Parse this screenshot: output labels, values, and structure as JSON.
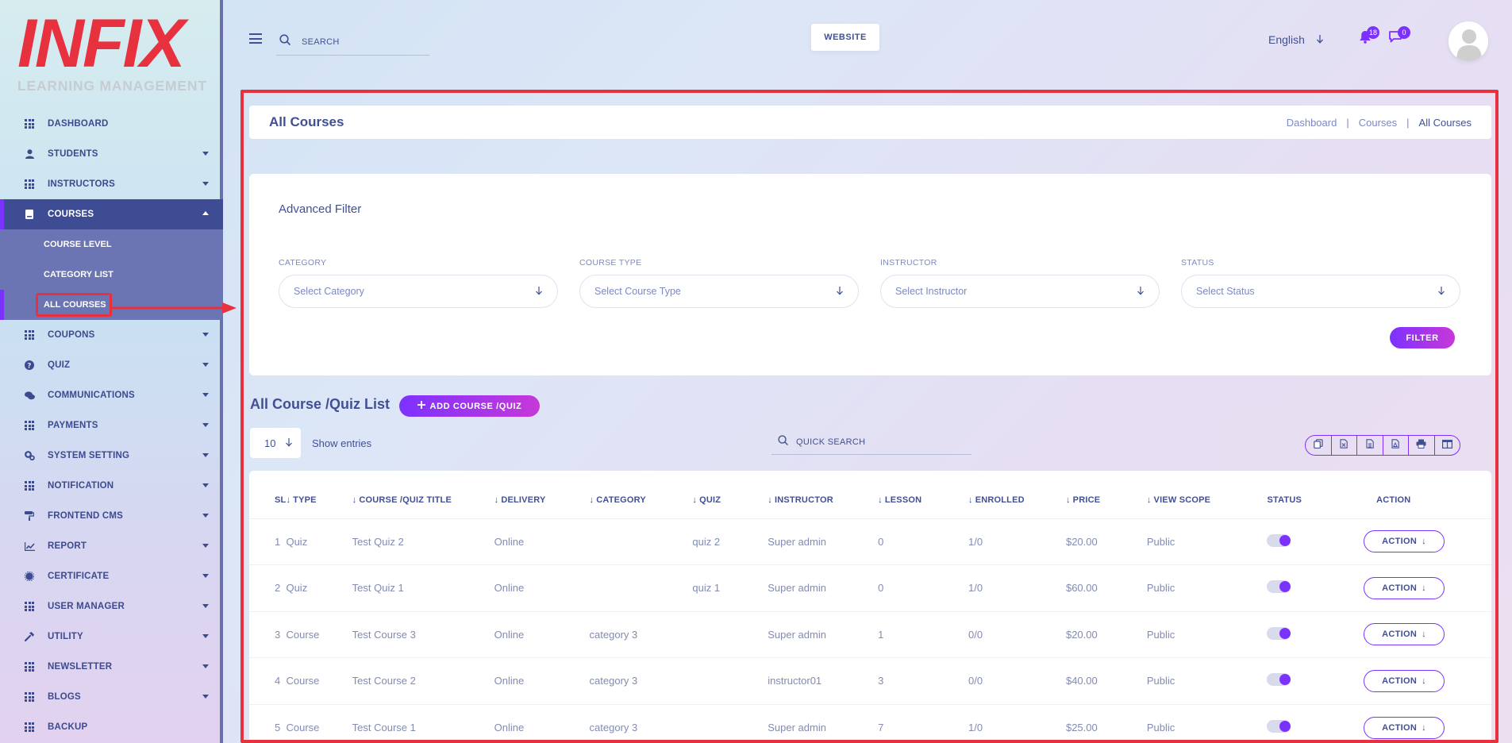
{
  "logo": {
    "word": "INFIX",
    "subtitle": "LEARNING MANAGEMENT"
  },
  "sidebar": {
    "items": [
      {
        "label": "DASHBOARD",
        "icon": "grid-icon"
      },
      {
        "label": "STUDENTS",
        "icon": "user-icon"
      },
      {
        "label": "INSTRUCTORS",
        "icon": "grid-icon"
      },
      {
        "label": "COURSES",
        "icon": "book-icon"
      },
      {
        "label": "COUPONS",
        "icon": "grid-icon"
      },
      {
        "label": "QUIZ",
        "icon": "question-icon"
      },
      {
        "label": "COMMUNICATIONS",
        "icon": "chat-icon"
      },
      {
        "label": "PAYMENTS",
        "icon": "grid-icon"
      },
      {
        "label": "SYSTEM SETTING",
        "icon": "cogs-icon"
      },
      {
        "label": "NOTIFICATION",
        "icon": "grid-icon"
      },
      {
        "label": "FRONTEND CMS",
        "icon": "paint-icon"
      },
      {
        "label": "REPORT",
        "icon": "chart-icon"
      },
      {
        "label": "CERTIFICATE",
        "icon": "certificate-icon"
      },
      {
        "label": "USER MANAGER",
        "icon": "grid-icon"
      },
      {
        "label": "UTILITY",
        "icon": "wrench-icon"
      },
      {
        "label": "NEWSLETTER",
        "icon": "grid-icon"
      },
      {
        "label": "BLOGS",
        "icon": "grid-icon"
      },
      {
        "label": "BACKUP",
        "icon": "grid-icon"
      }
    ],
    "courses_sub": [
      "COURSE LEVEL",
      "CATEGORY LIST",
      "ALL COURSES"
    ]
  },
  "header": {
    "search_placeholder": "SEARCH",
    "website_label": "WEBSITE",
    "language": "English",
    "notification_count": "18",
    "message_count": "0"
  },
  "page": {
    "title": "All Courses",
    "breadcrumb": [
      "Dashboard",
      "Courses",
      "All Courses"
    ]
  },
  "filter": {
    "title": "Advanced Filter",
    "fields": [
      {
        "label": "CATEGORY",
        "placeholder": "Select Category"
      },
      {
        "label": "COURSE TYPE",
        "placeholder": "Select Course Type"
      },
      {
        "label": "INSTRUCTOR",
        "placeholder": "Select Instructor"
      },
      {
        "label": "STATUS",
        "placeholder": "Select Status"
      }
    ],
    "button": "FILTER"
  },
  "list": {
    "title": "All Course /Quiz List",
    "add_button": "ADD COURSE /QUIZ",
    "entries_value": "10",
    "entries_label": "Show entries",
    "quick_search_placeholder": "QUICK SEARCH"
  },
  "table": {
    "columns": [
      "SL",
      "TYPE",
      "COURSE /QUIZ TITLE",
      "DELIVERY",
      "CATEGORY",
      "QUIZ",
      "INSTRUCTOR",
      "LESSON",
      "ENROLLED",
      "PRICE",
      "VIEW SCOPE",
      "STATUS",
      "ACTION"
    ],
    "rows": [
      [
        "1",
        "Quiz",
        "Test Quiz 2",
        "Online",
        "",
        "quiz 2",
        "Super admin",
        "0",
        "1/0",
        "$20.00",
        "Public"
      ],
      [
        "2",
        "Quiz",
        "Test Quiz 1",
        "Online",
        "",
        "quiz 1",
        "Super admin",
        "0",
        "1/0",
        "$60.00",
        "Public"
      ],
      [
        "3",
        "Course",
        "Test Course 3",
        "Online",
        "category 3",
        "",
        "Super admin",
        "1",
        "0/0",
        "$20.00",
        "Public"
      ],
      [
        "4",
        "Course",
        "Test Course 2",
        "Online",
        "category 3",
        "",
        "instructor01",
        "3",
        "0/0",
        "$40.00",
        "Public"
      ],
      [
        "5",
        "Course",
        "Test Course 1",
        "Online",
        "category 3",
        "",
        "Super admin",
        "7",
        "1/0",
        "$25.00",
        "Public"
      ]
    ],
    "action_label": "ACTION"
  },
  "colors": {
    "accent": "#7c32ff",
    "brand_red": "#e8313f",
    "text": "#415094"
  }
}
